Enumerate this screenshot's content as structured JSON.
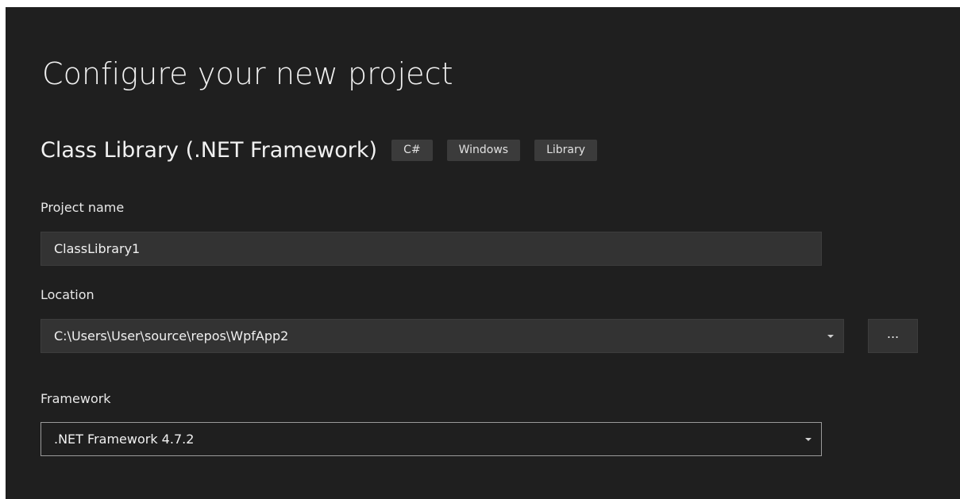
{
  "page": {
    "title": "Configure your new project"
  },
  "template": {
    "name": "Class Library (.NET Framework)",
    "tags": [
      "C#",
      "Windows",
      "Library"
    ]
  },
  "project_name": {
    "label": "Project name",
    "value": "ClassLibrary1"
  },
  "location": {
    "label": "Location",
    "value": "C:\\Users\\User\\source\\repos\\WpfApp2",
    "browse_label": "..."
  },
  "framework": {
    "label": "Framework",
    "value": ".NET Framework 4.7.2"
  },
  "icons": {
    "dropdown": "chevron-down-icon"
  },
  "colors": {
    "background": "#1f1f1f",
    "field_background": "#333333",
    "tag_background": "#3b3b3b",
    "text": "#f1f1f1",
    "focused_border": "#9a9a9a"
  }
}
